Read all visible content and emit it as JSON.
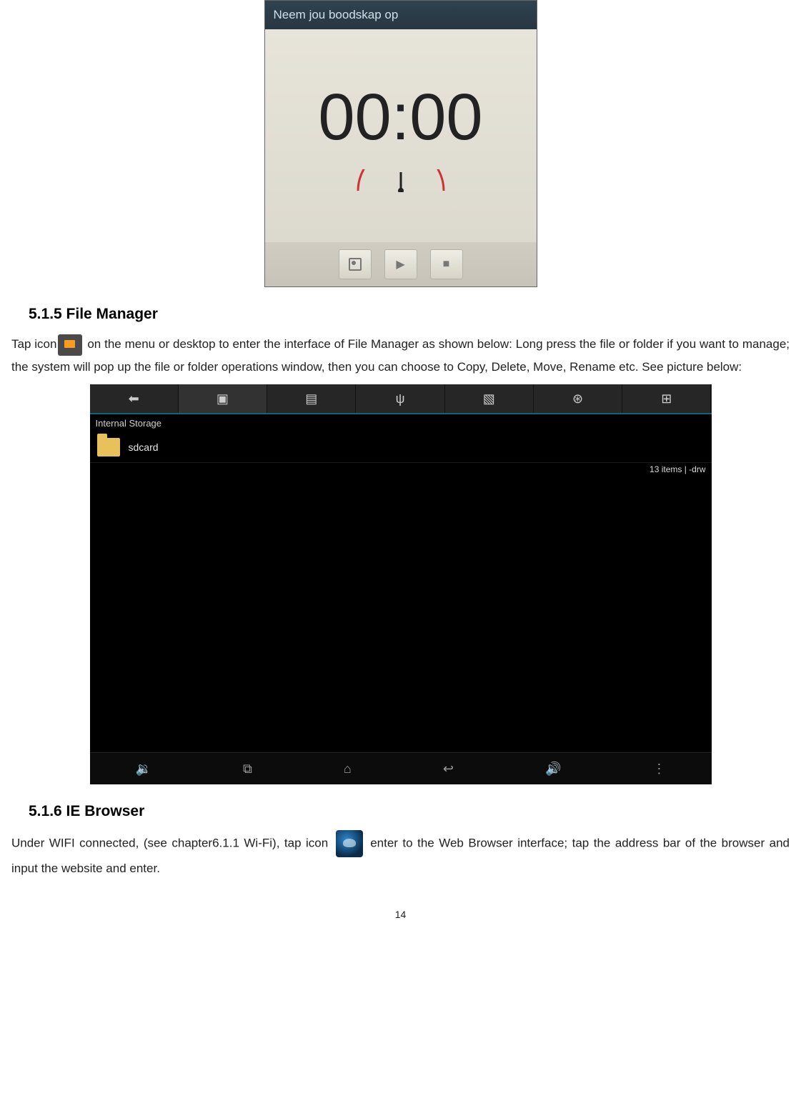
{
  "recorder": {
    "header_title": "Neem jou boodskap op",
    "time_display": "00:00"
  },
  "section_file_manager": {
    "heading": "5.1.5 File Manager",
    "para_before_icon": "Tap icon",
    "para_after_icon": " on the menu or desktop to enter the interface of File Manager as shown below: Long press the file or folder if you want to   manage; the system will pop up the file or folder operations window, then you can choose to Copy, Delete, Move, Rename etc. See picture below:"
  },
  "file_manager_shot": {
    "breadcrumb": "Internal Storage",
    "folder_name": "sdcard",
    "meta": "13 items | -drw"
  },
  "section_browser": {
    "heading": "5.1.6 IE Browser",
    "para_before_icon": "Under WIFI connected, (see chapter6.1.1 Wi-Fi), tap icon ",
    "para_after_icon": " enter to the Web Browser interface; tap the address bar of the browser and input the website and enter."
  },
  "page_number": "14"
}
